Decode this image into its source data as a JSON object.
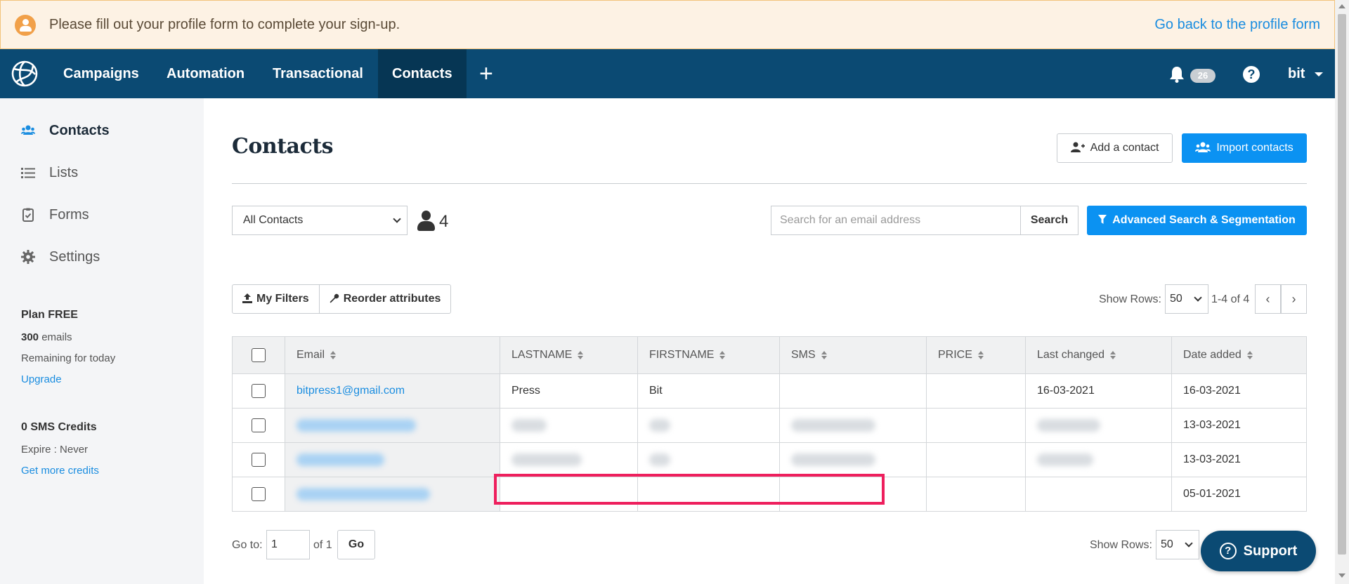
{
  "banner": {
    "message": "Please fill out your profile form to complete your sign-up.",
    "link": "Go back to the profile form",
    "icon": "user-circle-icon"
  },
  "nav": {
    "items": [
      "Campaigns",
      "Automation",
      "Transactional",
      "Contacts"
    ],
    "active": "Contacts",
    "notifications": "26",
    "user": "bit"
  },
  "sidebar": {
    "items": [
      {
        "label": "Contacts",
        "icon": "users-icon"
      },
      {
        "label": "Lists",
        "icon": "list-icon"
      },
      {
        "label": "Forms",
        "icon": "clipboard-icon"
      },
      {
        "label": "Settings",
        "icon": "gear-icon"
      }
    ],
    "plan_title": "Plan FREE",
    "emails_count": "300",
    "emails_label": " emails",
    "remaining": "Remaining for today",
    "upgrade": "Upgrade",
    "sms_title": "0 SMS Credits",
    "expire": "Expire : Never",
    "more_credits": "Get more credits"
  },
  "page": {
    "title": "Contacts",
    "add_contact": "Add a contact",
    "import_contacts": "Import contacts"
  },
  "toolbar": {
    "list_select": "All Contacts",
    "contact_count": "4",
    "search_placeholder": "Search for an email address",
    "search_button": "Search",
    "advanced": "Advanced Search & Segmentation"
  },
  "filters": {
    "my_filters": "My Filters",
    "reorder": "Reorder attributes",
    "show_rows_label": "Show Rows:",
    "rows_value": "50",
    "range": "1-4 of 4"
  },
  "table": {
    "columns": [
      "Email",
      "LASTNAME",
      "FIRSTNAME",
      "SMS",
      "PRICE",
      "Last changed",
      "Date added"
    ],
    "rows": [
      {
        "email": "bitpress1@gmail.com",
        "lastname": "Press",
        "firstname": "Bit",
        "sms": "",
        "price": "",
        "last_changed": "16-03-2021",
        "date_added": "16-03-2021"
      },
      {
        "email": "",
        "lastname": "",
        "firstname": "",
        "sms": "",
        "price": "",
        "last_changed": "",
        "date_added": "13-03-2021"
      },
      {
        "email": "",
        "lastname": "",
        "firstname": "",
        "sms": "",
        "price": "",
        "last_changed": "",
        "date_added": "13-03-2021"
      },
      {
        "email": "",
        "lastname": "",
        "firstname": "",
        "sms": "",
        "price": "",
        "last_changed": "",
        "date_added": "05-01-2021"
      }
    ]
  },
  "footer": {
    "goto_label": "Go to:",
    "goto_value": "1",
    "of_label": "of 1",
    "go_button": "Go",
    "show_rows_label": "Show Rows:",
    "rows_value": "50"
  },
  "support": "Support",
  "colors": {
    "nav": "#0b4a73",
    "primary": "#0b92f2",
    "link": "#1a8de0",
    "highlight": "#ee1f5d",
    "banner_bg": "#fdf2e4"
  }
}
